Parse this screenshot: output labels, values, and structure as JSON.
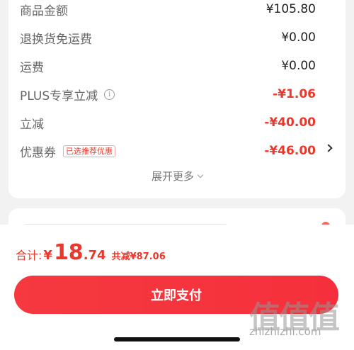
{
  "summary": {
    "rows": [
      {
        "label": "商品金额",
        "value": "¥105.80"
      },
      {
        "label": "退换货免运费",
        "value": "¥0.00"
      },
      {
        "label": "运费",
        "value": "¥0.00"
      },
      {
        "label": "PLUS专享立减",
        "value": "-¥1.06"
      },
      {
        "label": "立减",
        "value": "-¥40.00"
      },
      {
        "label": "优惠券",
        "value": "-¥46.00"
      }
    ],
    "coupon_tag": "已选推荐优惠",
    "expand_label": "展开更多"
  },
  "footer": {
    "total_label": "合计:",
    "currency": "¥",
    "total_int": "18",
    "total_dec": ".74",
    "saved": "共减¥87.06",
    "pay_button": "立即支付"
  },
  "watermark": {
    "mark": "值值值",
    "site": "zhizhizhi.com"
  },
  "colors": {
    "accent": "#e8392c",
    "button": "#f5393f",
    "background": "#f2f2f2"
  },
  "icons": {
    "info": "info-circle-icon",
    "coupon_arrow": "chevron-right-icon",
    "expand": "chevron-down-icon"
  }
}
